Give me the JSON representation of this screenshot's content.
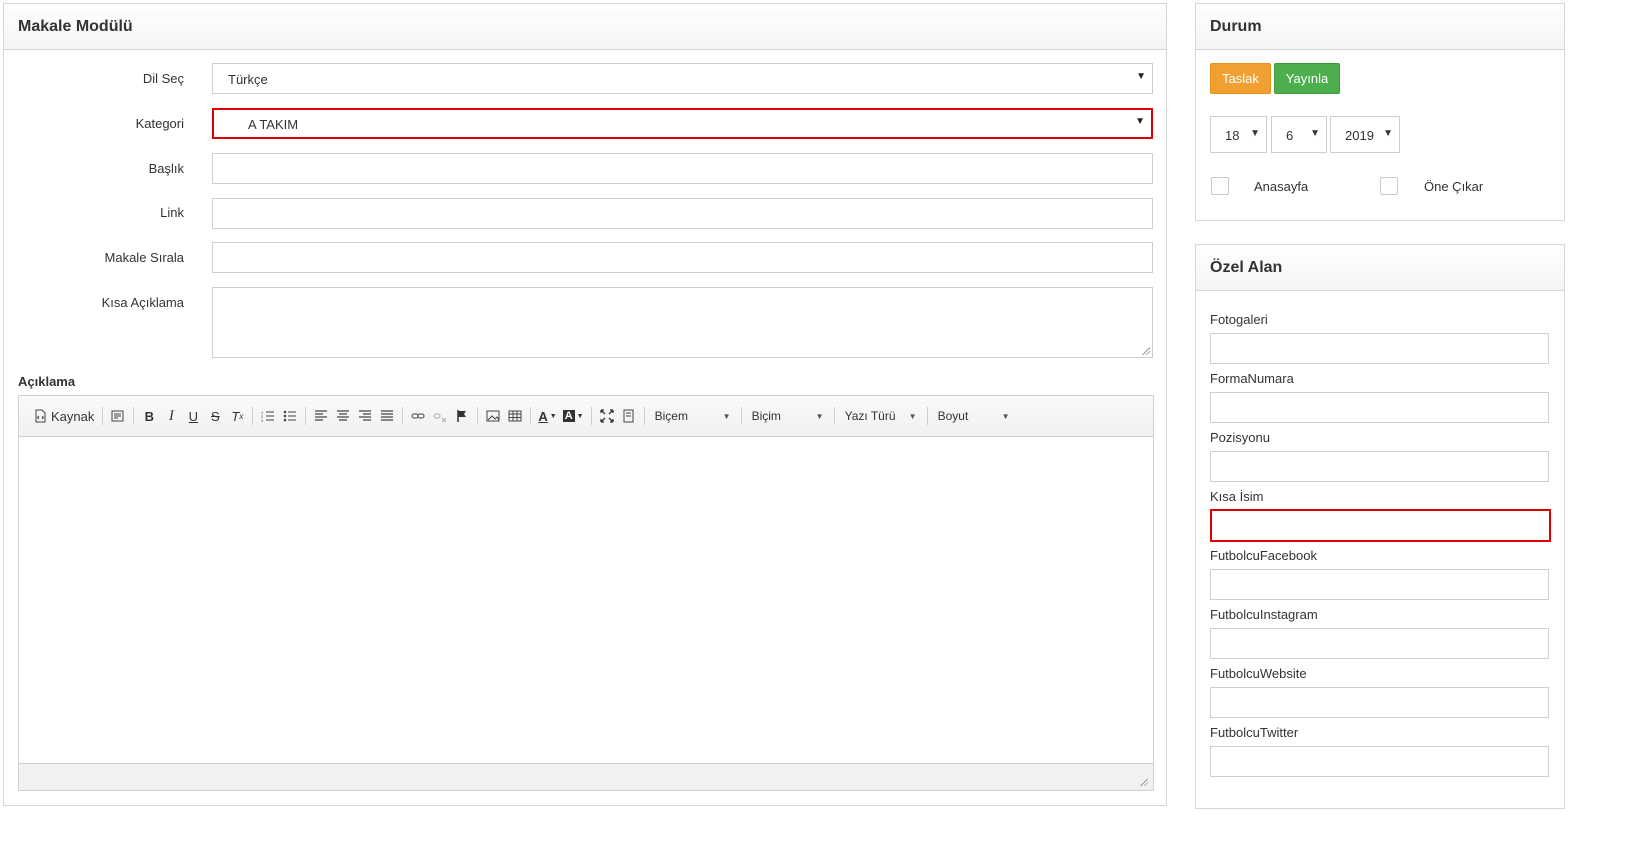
{
  "main": {
    "title": "Makale Modülü",
    "fields": {
      "dil_label": "Dil Seç",
      "dil_value": "Türkçe",
      "kategori_label": "Kategori",
      "kategori_value": "A TAKIM",
      "baslik_label": "Başlık",
      "link_label": "Link",
      "sirala_label": "Makale Sırala",
      "kisa_aciklama_label": "Kısa Açıklama"
    },
    "aciklama_label": "Açıklama",
    "editor": {
      "source_label": "Kaynak",
      "combo_bicem1": "Biçem",
      "combo_bicim": "Biçim",
      "combo_yazi_turu": "Yazı Türü",
      "combo_boyut": "Boyut"
    }
  },
  "durum": {
    "title": "Durum",
    "taslak_label": "Taslak",
    "yayinla_label": "Yayınla",
    "day": "18",
    "month": "6",
    "year": "2019",
    "anasayfa_label": "Anasayfa",
    "one_cikar_label": "Öne Çıkar"
  },
  "ozel": {
    "title": "Özel Alan",
    "fields": [
      "Fotogaleri",
      "FormaNumara",
      "Pozisyonu",
      "Kısa İsim",
      "FutbolcuFacebook",
      "FutbolcuInstagram",
      "FutbolcuWebsite",
      "FutbolcuTwitter"
    ]
  },
  "colors": {
    "highlight": "#e00000",
    "taslak_bg": "#f0a030",
    "yayinla_bg": "#4cae4c"
  }
}
